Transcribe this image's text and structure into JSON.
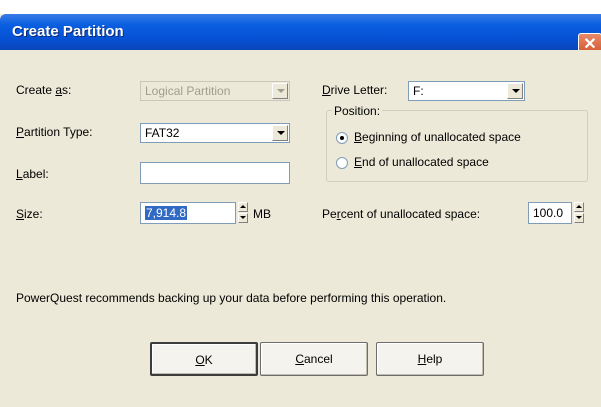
{
  "window": {
    "title": "Create Partition",
    "close_glyph": "✕"
  },
  "create_as": {
    "label_pre": "Create ",
    "label_ul": "a",
    "label_post": "s:",
    "value": "Logical Partition"
  },
  "partition_type": {
    "label_pre": "",
    "label_ul": "P",
    "label_post": "artition Type:",
    "value": "FAT32"
  },
  "label_field": {
    "label_pre": "",
    "label_ul": "L",
    "label_post": "abel:",
    "value": ""
  },
  "size": {
    "label_pre": "",
    "label_ul": "S",
    "label_post": "ize:",
    "value": "7,914.8",
    "unit": "MB"
  },
  "drive_letter": {
    "label_pre": "",
    "label_ul": "D",
    "label_post": "rive Letter:",
    "value": "F:"
  },
  "position": {
    "title": "Position:",
    "option_beginning": {
      "ul": "B",
      "rest": "eginning of unallocated space",
      "selected": true
    },
    "option_end": {
      "ul": "E",
      "rest": "nd of unallocated space",
      "selected": false
    }
  },
  "percent": {
    "label_pre": "Pe",
    "label_ul": "r",
    "label_post": "cent of unallocated space:",
    "value": "100.0"
  },
  "message": "PowerQuest recommends backing up your data before performing this operation.",
  "buttons": {
    "ok": {
      "ul": "O",
      "rest": "K"
    },
    "cancel": {
      "ul": "C",
      "rest": "ancel"
    },
    "help": {
      "ul": "H",
      "rest": "elp"
    }
  },
  "colors": {
    "titlebar": "#0650d4",
    "dialog_bg": "#ece9d8",
    "selection": "#316ac5",
    "close": "#d04a20"
  }
}
